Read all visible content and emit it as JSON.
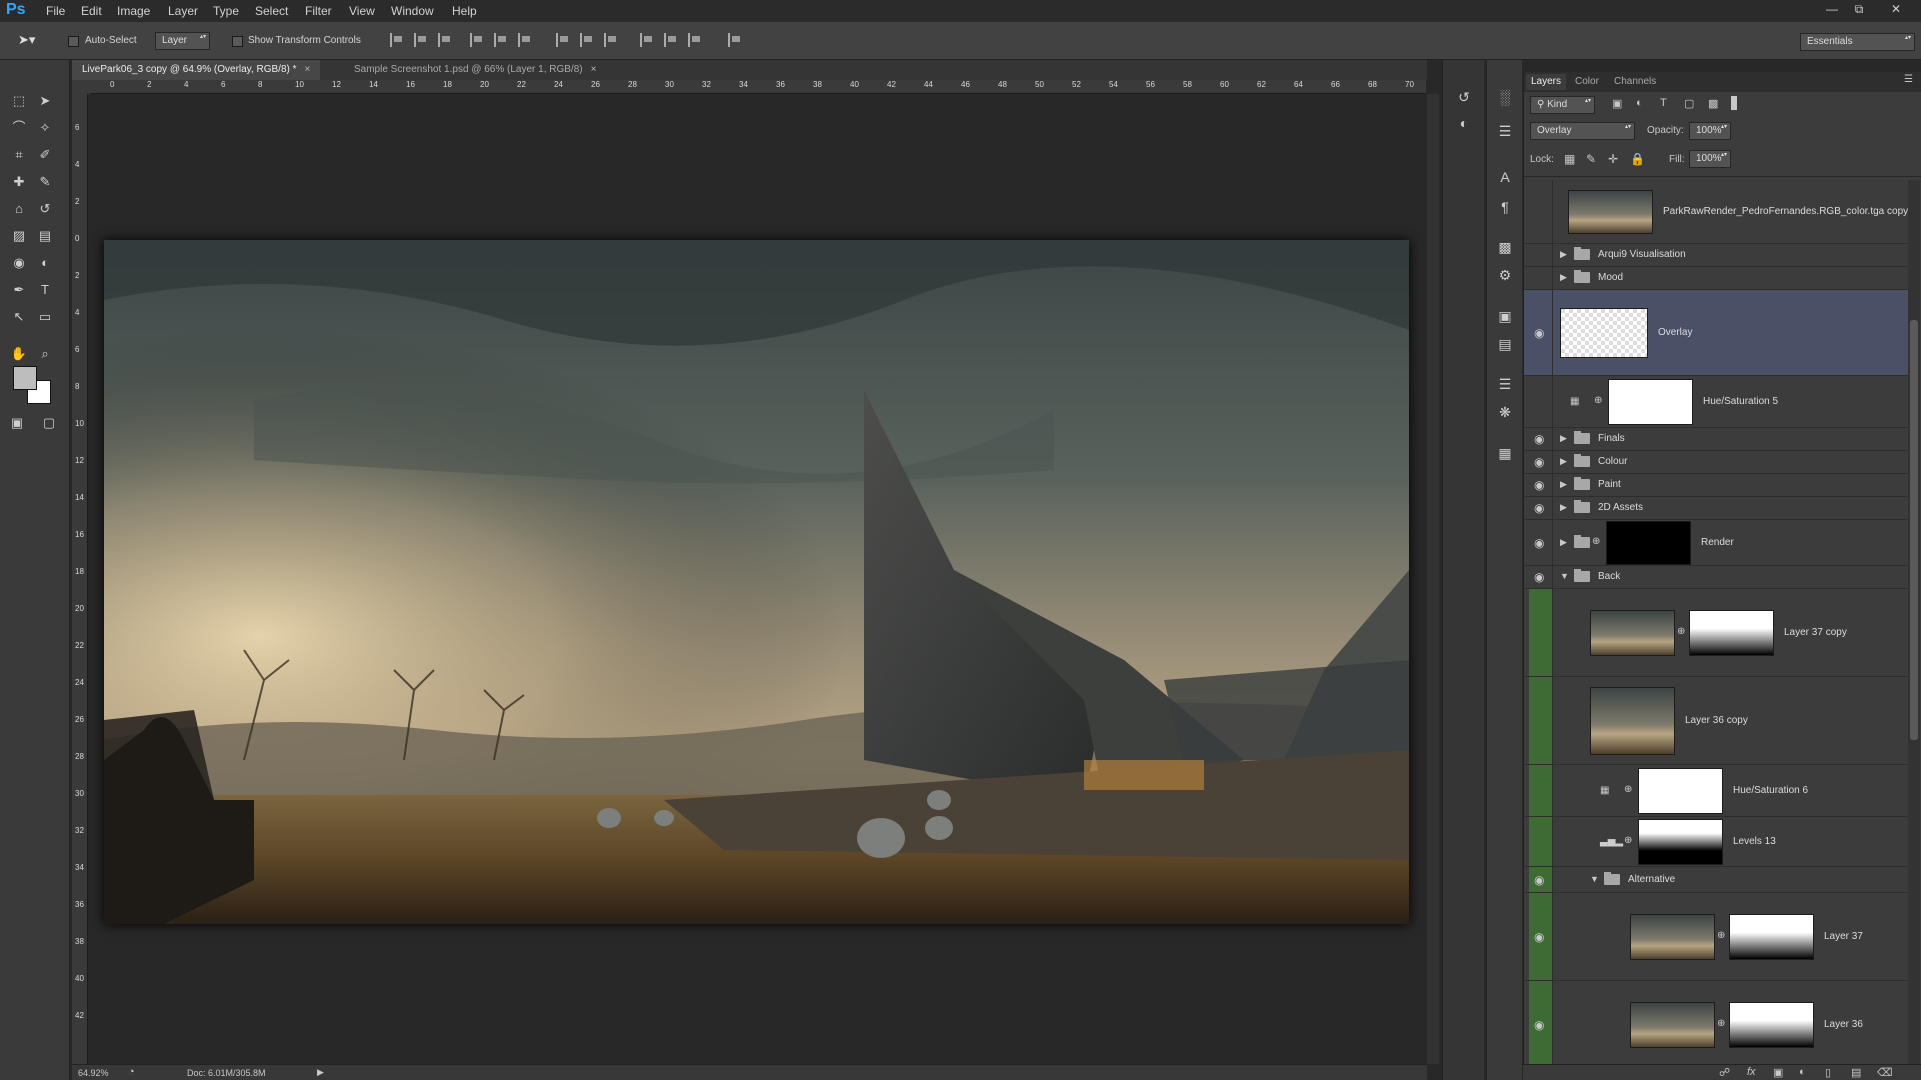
{
  "app": {
    "logo": "Ps"
  },
  "menu": [
    "File",
    "Edit",
    "Image",
    "Layer",
    "Type",
    "Select",
    "Filter",
    "View",
    "Window",
    "Help"
  ],
  "window_controls": {
    "minimize": "—",
    "restore": "⧉",
    "close": "✕"
  },
  "options": {
    "auto_select_label": "Auto-Select",
    "auto_select_checked": false,
    "target_value": "Layer",
    "show_transform_label": "Show Transform Controls",
    "show_transform_checked": false,
    "workspace": "Essentials"
  },
  "tabs": [
    {
      "label": "LivePark06_3 copy @ 64.9% (Overlay, RGB/8) *",
      "close": "×",
      "active": true
    },
    {
      "label": "Sample Screenshot 1.psd @ 66% (Layer 1, RGB/8)",
      "close": "×",
      "active": false
    }
  ],
  "ruler": {
    "h_ticks": [
      "0",
      "2",
      "4",
      "6",
      "8",
      "10",
      "12",
      "14",
      "16",
      "18",
      "20",
      "22",
      "24",
      "26",
      "28",
      "30",
      "32",
      "34",
      "36",
      "38",
      "40",
      "42",
      "44",
      "46",
      "48",
      "50",
      "52",
      "54",
      "56",
      "58",
      "60",
      "62",
      "64",
      "66",
      "68",
      "70"
    ],
    "v_ticks": [
      "6",
      "4",
      "2",
      "0",
      "2",
      "4",
      "6",
      "8",
      "10",
      "12",
      "14",
      "16",
      "18",
      "20",
      "22",
      "24",
      "26",
      "28",
      "30",
      "32",
      "34",
      "36",
      "38",
      "40",
      "42"
    ]
  },
  "status": {
    "zoom": "64.92%",
    "doc": "Doc: 6.01M/305.8M"
  },
  "tools": [
    "marquee-tool",
    "move-tool",
    "lasso-tool",
    "magic-wand-tool",
    "crop-tool",
    "eyedropper-tool",
    "healing-tool",
    "brush-tool",
    "clone-stamp-tool",
    "history-brush-tool",
    "eraser-tool",
    "gradient-tool",
    "blur-tool",
    "dodge-tool",
    "pen-tool",
    "type-tool",
    "path-select-tool",
    "shape-tool",
    "hand-tool",
    "zoom-tool"
  ],
  "tool_glyphs": [
    "⬚",
    "➤",
    "⌒",
    "✧",
    "⌗",
    "✐",
    "✚",
    "✎",
    "⌂",
    "↺",
    "▨",
    "▤",
    "◉",
    "◐",
    "✒",
    "T",
    "↖",
    "▭",
    "✋",
    "⌕"
  ],
  "colors": {
    "foreground": "#bdbdbd",
    "background": "#ffffff",
    "selected_layer": "#4a5066",
    "accent": "#31a8ff"
  },
  "panel": {
    "tabs": [
      "Layers",
      "Color",
      "Channels"
    ],
    "filter_label": "Kind",
    "blend_mode": "Overlay",
    "opacity_label": "Opacity:",
    "opacity": "100%",
    "lock_label": "Lock:",
    "fill_label": "Fill:",
    "fill": "100%"
  },
  "layers": [
    {
      "name": "ParkRawRender_PedroFernandes.RGB_color.tga copy",
      "kind": "image",
      "visible": false
    },
    {
      "name": "Arqui9 Visualisation",
      "kind": "group",
      "visible": false
    },
    {
      "name": "Mood",
      "kind": "group",
      "visible": false
    },
    {
      "name": "Overlay",
      "kind": "transparent",
      "visible": true,
      "selected": true
    },
    {
      "name": "Hue/Saturation 5",
      "kind": "adjustment",
      "visible": false
    },
    {
      "name": "Finals",
      "kind": "group",
      "visible": true
    },
    {
      "name": "Colour",
      "kind": "group",
      "visible": true
    },
    {
      "name": "Paint",
      "kind": "group",
      "visible": true
    },
    {
      "name": "2D Assets",
      "kind": "group",
      "visible": true
    },
    {
      "name": "Render",
      "kind": "group-mask",
      "visible": true
    },
    {
      "name": "Back",
      "kind": "group-open",
      "visible": true
    },
    {
      "name": "Layer 37 copy",
      "kind": "image-mask",
      "visible": false
    },
    {
      "name": "Layer 36 copy",
      "kind": "image",
      "visible": false
    },
    {
      "name": "Hue/Saturation 6",
      "kind": "adjustment",
      "visible": false
    },
    {
      "name": "Levels 13",
      "kind": "levels",
      "visible": false
    },
    {
      "name": "Alternative",
      "kind": "group-open",
      "visible": true
    },
    {
      "name": "Layer 37",
      "kind": "image-mask",
      "visible": true
    },
    {
      "name": "Layer 36",
      "kind": "image-mask",
      "visible": true
    }
  ]
}
